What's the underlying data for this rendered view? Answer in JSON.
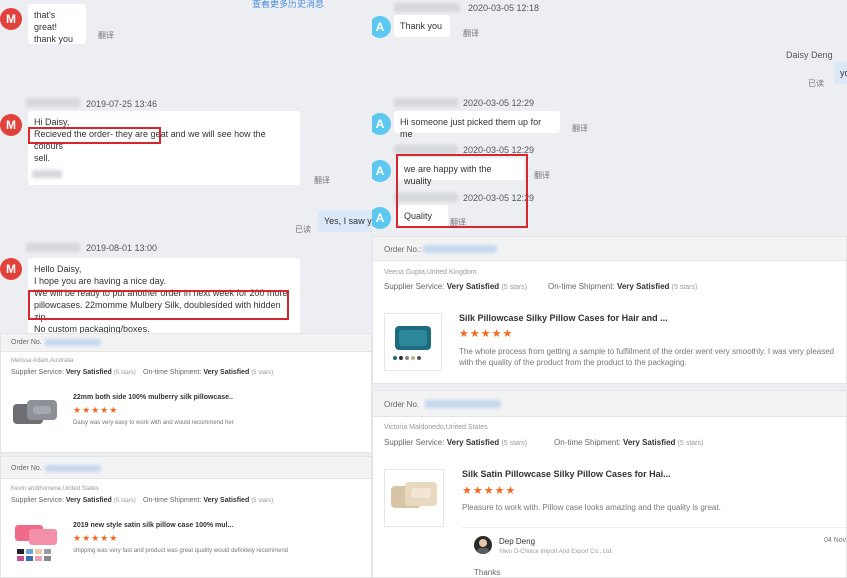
{
  "chat_left": {
    "history_link": "查看更多历史消息",
    "translate": "翻译",
    "read": "已读",
    "msg1": {
      "line1": "that's great!",
      "line2": "thank you"
    },
    "msg2": {
      "time": "2019-07-25 13:46",
      "greeting": "Hi Daisy,",
      "line1_hl": "Recieved the order- they are geat",
      "line1_rest": " and we will see how the colours",
      "line2": "sell."
    },
    "reply": {
      "text": "Yes, I saw y"
    },
    "msg3": {
      "time": "2019-08-01 13:00",
      "line1": "Hello Daisy,",
      "line2": "I hope you are having a nice day.",
      "line3": "We will be ready to put another order in next week for 200 more",
      "line4": "pillowcases. 22momme Mulbery Silk, doublesided with hidden zip.",
      "line5": "No custom packaging/boxes."
    },
    "avatar_letter": "M"
  },
  "chat_right": {
    "avatar_letter": "A",
    "translate": "翻译",
    "read": "已读",
    "time0": "2020-03-05 12:18",
    "msg0": "Thank you",
    "seller_name": "Daisy Deng",
    "seller_msg": "yo",
    "time1": "2020-03-05 12:29",
    "msg1": "Hi someone just picked them up for me",
    "time2": "2020-03-05 12:29",
    "msg2": "we are happy with the wuality",
    "time3": "2020-03-05 12:29",
    "msg3": "Quality"
  },
  "review_left_1": {
    "order_label": "Order No.",
    "buyer": "Melissa Adam,Australia",
    "supplier_label": "Supplier Service:",
    "supplier_value": "Very Satisfied",
    "supplier_stars": "(5 stars)",
    "shipment_label": "On-time Shipment:",
    "shipment_value": "Very Satisfied",
    "shipment_stars": "(5 stars)",
    "product": "22mm both side 100% mulberry silk pillowcase..",
    "stars": "★★★★★",
    "comment": "Daisy was very easy to work with and would recommend her"
  },
  "review_left_2": {
    "order_label": "Order No.",
    "buyer": "Kevin andthomene,United States",
    "supplier_label": "Supplier Service:",
    "supplier_value": "Very Satisfied",
    "supplier_stars": "(5 stars)",
    "shipment_label": "On-time Shipment:",
    "shipment_value": "Very Satisfied",
    "shipment_stars": "(5 stars)",
    "product": "2019 new style satin silk pillow case 100% mul...",
    "stars": "★★★★★",
    "comment": "shipping was very fast and product was great quality would definitely recommend"
  },
  "review_right_1": {
    "order_label": "Order No.:",
    "buyer": "Veena Gupta,United Kingdom",
    "supplier_label": "Supplier Service:",
    "supplier_value": "Very Satisfied",
    "supplier_stars": "(5 stars)",
    "shipment_label": "On-time Shipment:",
    "shipment_value": "Very Satisfied",
    "shipment_stars": "(5 stars)",
    "product": "Silk Pillowcase Silky Pillow Cases for Hair and ...",
    "stars": "★★★★★",
    "comment_line1": "The whole process from getting a sample to fulfillment of the order went very smoothly. I was very pleased",
    "comment_line2": "with the quality of the product from the product to the packaging."
  },
  "review_right_2": {
    "order_label": "Order No.",
    "buyer": "Victoria Maldonedo,United States",
    "supplier_label": "Supplier Service:",
    "supplier_value": "Very Satisfied",
    "supplier_stars": "(5 stars)",
    "shipment_label": "On-time Shipment:",
    "shipment_value": "Very Satisfied",
    "shipment_stars": "(5 stars)",
    "product": "Silk Satin Pillowcase Silky Pillow Cases for Hai...",
    "stars": "★★★★★",
    "comment": "Pleasure to work with. Pillow case looks amazing and the quality is great.",
    "reply_name": "Dep Deng",
    "reply_company": "Yiwu O-Choice Import And Export Co., Ltd.",
    "reply_date": "04 Nov",
    "reply_text": "Thanks"
  },
  "colors": {
    "highlight_red": "#d8262f",
    "star_orange": "#f5681f",
    "avatar_red": "#e2403b",
    "avatar_blue": "#5cc8f0"
  }
}
